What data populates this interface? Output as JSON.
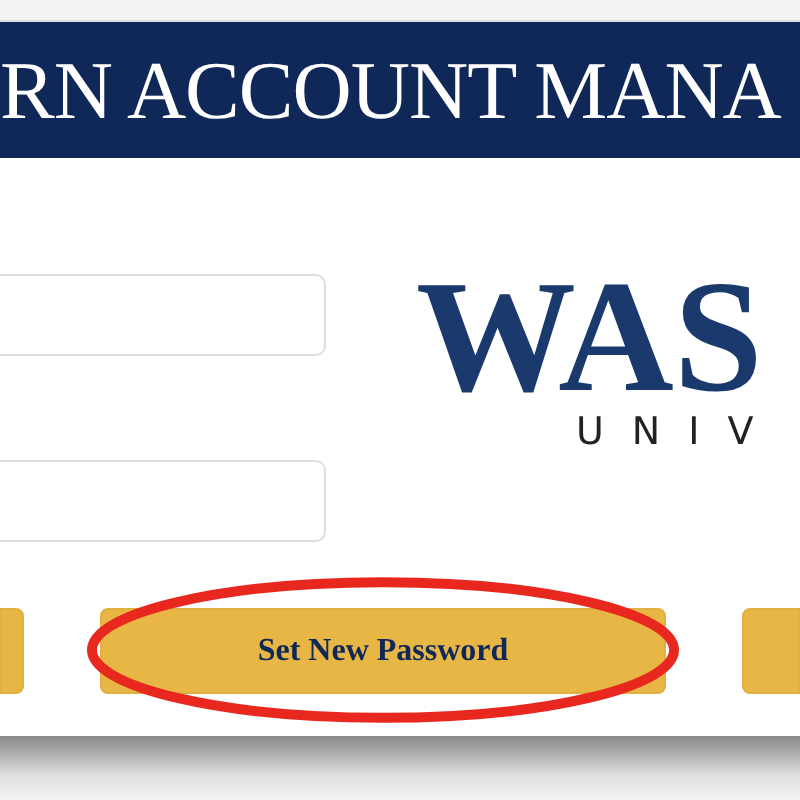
{
  "header": {
    "title": "RN ACCOUNT MANA"
  },
  "fields": [
    {
      "kind": "input"
    },
    {
      "kind": "input"
    }
  ],
  "logo": {
    "wordmark": "WAS",
    "subtitle": "UNIV"
  },
  "buttons": [
    {
      "kind": "edge-left"
    },
    {
      "kind": "full",
      "label": "Set New Password",
      "highlighted": true
    },
    {
      "kind": "edge-right"
    }
  ]
}
